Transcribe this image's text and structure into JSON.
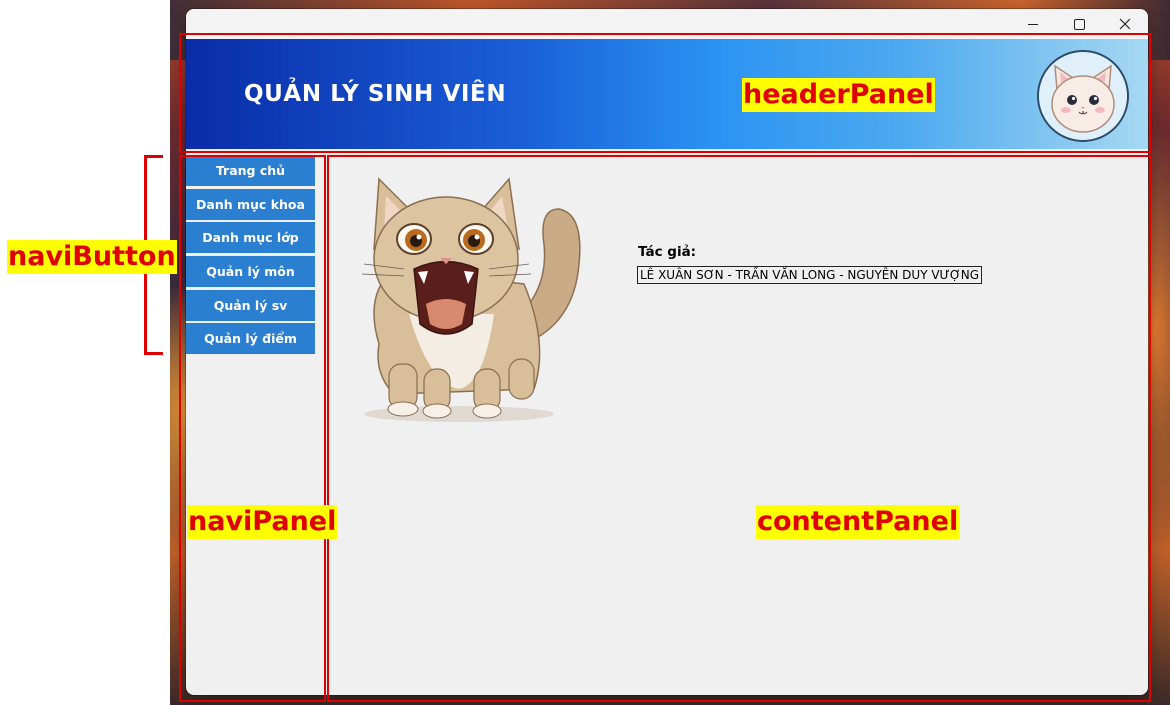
{
  "window": {
    "controls": [
      "minimize",
      "maximize",
      "close"
    ]
  },
  "header": {
    "title": "QUẢN LÝ SINH VIÊN",
    "avatar_icon": "cat-avatar-icon",
    "gradient_start": "#0a2ca8",
    "gradient_end": "#a6d8f2"
  },
  "navigation": {
    "items": [
      {
        "label": "Trang chủ"
      },
      {
        "label": "Danh mục khoa"
      },
      {
        "label": "Danh mục lớp"
      },
      {
        "label": "Quản lý môn"
      },
      {
        "label": "Quản lý sv"
      },
      {
        "label": "Quản lý điểm"
      }
    ],
    "button_color": "#2b7fd0"
  },
  "content": {
    "image_icon": "roaring-cat-illustration",
    "author_label": "Tác giả:",
    "author_names": "LÊ XUÂN SƠN - TRẦN VĂN LONG - NGUYỄN DUY VƯỢNG"
  },
  "annotations": {
    "header_panel": "headerPanel",
    "navi_button": "naviButton",
    "navi_panel": "naviPanel",
    "content_panel": "contentPanel",
    "color": "#e00000",
    "highlight": "#ffff00"
  }
}
